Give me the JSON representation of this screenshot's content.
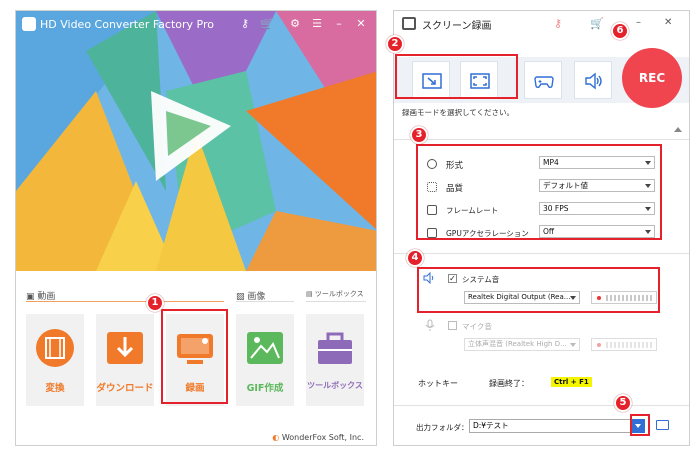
{
  "left_window": {
    "app_title": "HD Video Converter Factory Pro",
    "categories": {
      "video": "動画",
      "image": "画像",
      "toolbox": "ツールボックス"
    },
    "tiles": [
      {
        "label": "変換",
        "icon": "film-icon",
        "color": "#f07a2a"
      },
      {
        "label": "ダウンロード",
        "icon": "download-icon",
        "color": "#f07a2a"
      },
      {
        "label": "録画",
        "icon": "screen-recorder-icon",
        "color": "#f07a2a"
      },
      {
        "label": "GIF作成",
        "icon": "image-icon",
        "color": "#5cb85c"
      },
      {
        "label": "ツールボックス",
        "icon": "toolbox-icon",
        "color": "#8e6bb8"
      }
    ],
    "copyright": "WonderFox Soft, Inc."
  },
  "right_window": {
    "title": "スクリーン録画",
    "mode_hint": "録画モードを選択してください。",
    "rec_label": "REC",
    "settings": [
      {
        "label": "形式",
        "value": "MP4"
      },
      {
        "label": "品質",
        "value": "デフォルト値"
      },
      {
        "label": "フレームレート",
        "value": "30 FPS"
      },
      {
        "label": "GPUアクセラレーション",
        "value": "Off"
      }
    ],
    "system_audio": {
      "label": "システム音",
      "device": "Realtek Digital Output (Rea...",
      "checked": "✓"
    },
    "mic": {
      "label": "マイク音",
      "device": "立体声混音 (Realtek High D..."
    },
    "hotkey": {
      "label": "ホットキー",
      "action": "録画終了：",
      "keys": "Ctrl + F1"
    },
    "output": {
      "label": "出力フォルダ：",
      "path": "D:¥テスト"
    }
  },
  "annotations": [
    "1",
    "2",
    "3",
    "4",
    "5",
    "6"
  ],
  "colors": {
    "accent_red": "#e5212b",
    "rec_red": "#f0444f",
    "tile_orange": "#f07a2a"
  }
}
